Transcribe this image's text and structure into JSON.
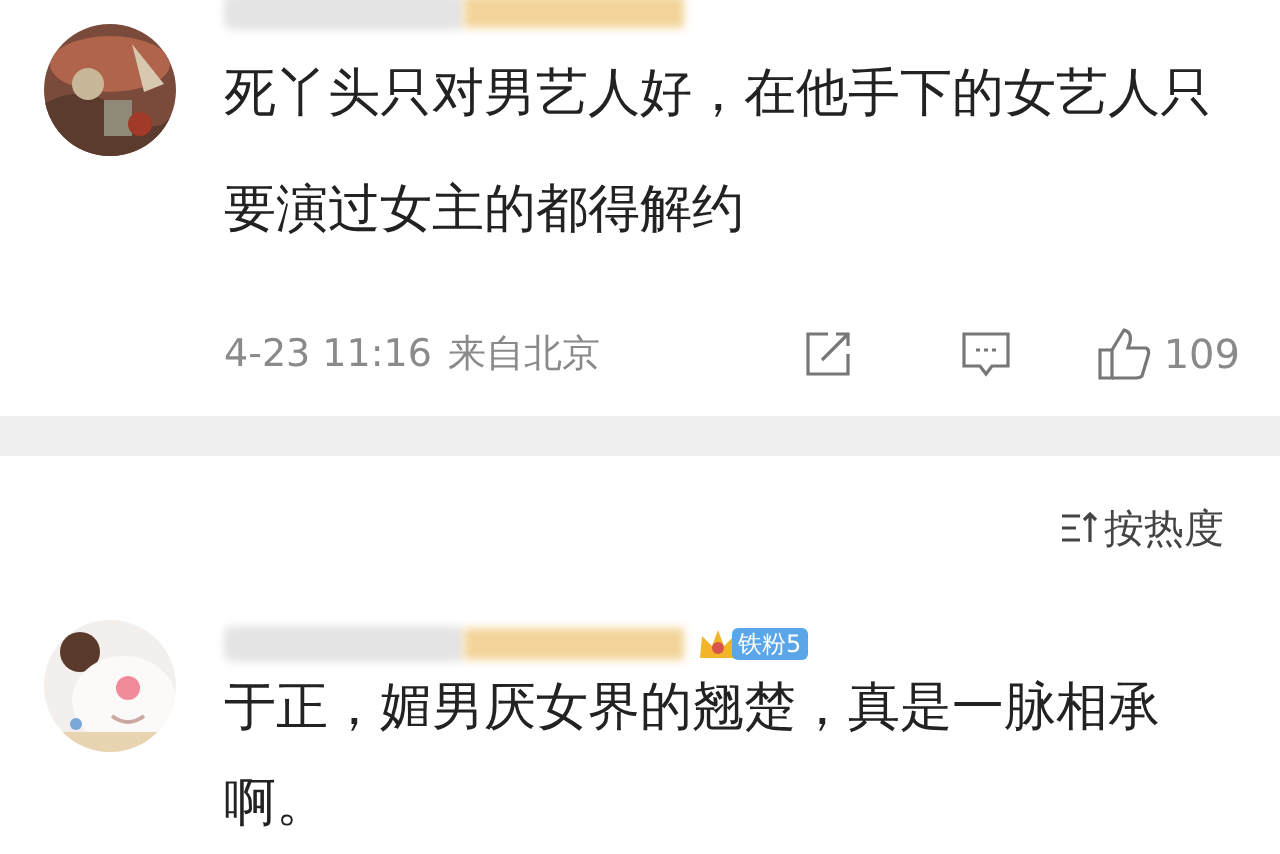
{
  "comments": [
    {
      "text": "死丫头只对男艺人好，在他手下的女艺人只要演过女主的都得解约",
      "time": "4-23 11:16",
      "location": "来自北京",
      "likes": "109"
    },
    {
      "badge": "铁粉5",
      "text": "于正，媚男厌女界的翘楚，真是一脉相承啊。"
    }
  ],
  "sort": {
    "label": "按热度"
  }
}
